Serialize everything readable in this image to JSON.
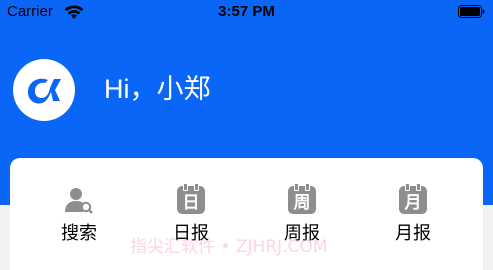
{
  "status_bar": {
    "carrier": "Carrier",
    "time": "3:57 PM"
  },
  "header": {
    "avatar_icon": "alpha-logo",
    "greeting": "Hi，小郑",
    "background_color": "#0a66f7"
  },
  "menu": {
    "items": [
      {
        "label": "搜索",
        "icon": "user-search-icon"
      },
      {
        "label": "日报",
        "icon": "calendar-day-icon",
        "glyph": "日"
      },
      {
        "label": "周报",
        "icon": "calendar-week-icon",
        "glyph": "周"
      },
      {
        "label": "月报",
        "icon": "calendar-month-icon",
        "glyph": "月"
      }
    ]
  },
  "watermark": "指尖汇软件 • ZJHRJ.COM"
}
